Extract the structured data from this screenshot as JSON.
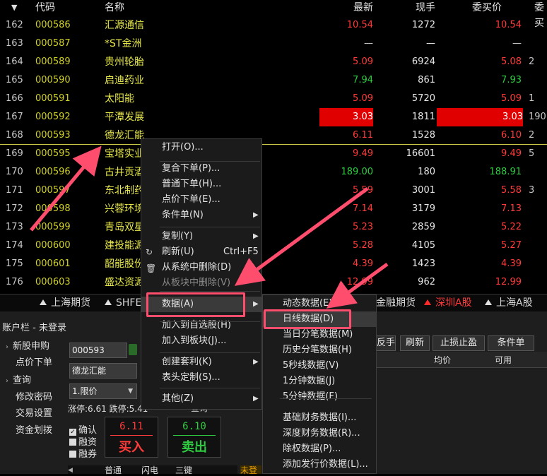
{
  "header": {
    "sort_arrow": "▼",
    "code": "代码",
    "name": "名称",
    "last": "最新",
    "current_vol": "现手",
    "bid": "委买价",
    "bid_vol": "委买"
  },
  "rows": [
    {
      "idx": "162",
      "code": "000586",
      "name": "汇源通信",
      "last": "10.54",
      "cur": "1272",
      "bid": "10.54",
      "bv": "",
      "dir": "up"
    },
    {
      "idx": "163",
      "code": "000587",
      "name": "*ST金洲",
      "last": "—",
      "cur": "—",
      "bid": "—",
      "bv": "",
      "dir": "flat"
    },
    {
      "idx": "164",
      "code": "000589",
      "name": "贵州轮胎",
      "last": "5.09",
      "cur": "6924",
      "bid": "5.08",
      "bv": "2",
      "dir": "up"
    },
    {
      "idx": "165",
      "code": "000590",
      "name": "启迪药业",
      "last": "7.94",
      "cur": "861",
      "bid": "7.93",
      "bv": "",
      "dir": "dn"
    },
    {
      "idx": "166",
      "code": "000591",
      "name": "太阳能",
      "last": "5.09",
      "cur": "5720",
      "bid": "5.09",
      "bv": "1",
      "dir": "up"
    },
    {
      "idx": "167",
      "code": "000592",
      "name": "平潭发展",
      "last": "3.03",
      "cur": "1811",
      "bid": "3.03",
      "bv": "190",
      "dir": "up",
      "hl": true
    },
    {
      "idx": "168",
      "code": "000593",
      "name": "德龙汇能",
      "last": "6.11",
      "cur": "1528",
      "bid": "6.10",
      "bv": "2",
      "dir": "up"
    },
    {
      "idx": "169",
      "code": "000595",
      "name": "宝塔实业",
      "last": "9.49",
      "cur": "16601",
      "bid": "9.49",
      "bv": "5",
      "dir": "up"
    },
    {
      "idx": "170",
      "code": "000596",
      "name": "古井贡酒",
      "last": "189.00",
      "cur": "180",
      "bid": "188.91",
      "bv": "",
      "dir": "dn"
    },
    {
      "idx": "171",
      "code": "000597",
      "name": "东北制药",
      "last": "5.59",
      "cur": "3001",
      "bid": "5.58",
      "bv": "3",
      "dir": "up"
    },
    {
      "idx": "172",
      "code": "000598",
      "name": "兴蓉环境",
      "last": "7.14",
      "cur": "3179",
      "bid": "7.13",
      "bv": "",
      "dir": "up"
    },
    {
      "idx": "173",
      "code": "000599",
      "name": "青岛双星",
      "last": "5.23",
      "cur": "2859",
      "bid": "5.22",
      "bv": "",
      "dir": "up"
    },
    {
      "idx": "174",
      "code": "000600",
      "name": "建投能源",
      "last": "5.28",
      "cur": "4105",
      "bid": "5.27",
      "bv": "",
      "dir": "up"
    },
    {
      "idx": "175",
      "code": "000601",
      "name": "韶能股份",
      "last": "4.39",
      "cur": "1423",
      "bid": "4.39",
      "bv": "",
      "dir": "up"
    },
    {
      "idx": "176",
      "code": "000603",
      "name": "盛达资源",
      "last": "12.99",
      "cur": "962",
      "bid": "12.99",
      "bv": "",
      "dir": "up"
    }
  ],
  "market_tabs": {
    "sh_futures": "上海期货",
    "shfe": "SHFE",
    "fin_futures": "金融期货",
    "sz_a": "深圳A股",
    "sh_a": "上海A股"
  },
  "account": {
    "title": "账户栏 - 未登录",
    "nav": [
      "新股申购",
      "点价下单",
      "查询",
      "修改密码",
      "交易设置",
      "资金划拨"
    ],
    "code_value": "000593",
    "name_value": "德龙汇能",
    "order_type": "1.限价",
    "limits": "涨停:6.61 跌停:5.41",
    "query_btn": "查询",
    "checks": [
      {
        "label": "确认",
        "checked": true
      },
      {
        "label": "融资",
        "checked": false
      },
      {
        "label": "融券",
        "checked": false
      }
    ],
    "buy_price": "6.11",
    "buy_label": "买入",
    "sell_price": "6.10",
    "sell_label": "卖出",
    "bottom_tabs": [
      "普通",
      "闪电",
      "三键"
    ],
    "right_buttons": [
      "反手",
      "刷新",
      "止损止盈",
      "条件单"
    ],
    "cols": [
      "均价",
      "可用"
    ],
    "partial_tab": "未登"
  },
  "context_menu": {
    "items": [
      {
        "label": "打开(O)..."
      },
      {
        "label": "复合下单(P)..."
      },
      {
        "label": "普通下单(H)..."
      },
      {
        "label": "点价下单(E)..."
      },
      {
        "label": "条件单(N)",
        "arrow": "▶"
      },
      {
        "label": "复制(Y)",
        "arrow": "▶"
      },
      {
        "label": "刷新(U)",
        "shortcut": "Ctrl+F5"
      },
      {
        "label": "从系统中删除(D)"
      },
      {
        "label": "从板块中删除(V)"
      },
      {
        "label": "数据(A)",
        "arrow": "▶"
      },
      {
        "label": "加入到自选股(H)"
      },
      {
        "label": "加入到板块(J)..."
      },
      {
        "label": "创建套利(K)",
        "arrow": "▶"
      },
      {
        "label": "表头定制(S)..."
      },
      {
        "label": "其他(Z)",
        "arrow": "▶"
      }
    ]
  },
  "submenu": {
    "items": [
      {
        "label": "动态数据(E)..."
      },
      {
        "label": "日线数据(D)"
      },
      {
        "label": "当日分笔数据(M)"
      },
      {
        "label": "历史分笔数据(H)"
      },
      {
        "label": "5秒线数据(V)"
      },
      {
        "label": "1分钟数据(J)"
      },
      {
        "label": "5分钟数据(F)"
      },
      {
        "label": "基础财务数据(I)..."
      },
      {
        "label": "深度财务数据(R)..."
      },
      {
        "label": "除权数据(P)..."
      },
      {
        "label": "添加发行价数据(L)..."
      }
    ]
  },
  "colors": {
    "up": "#ff3b3b",
    "down": "#2ecc40",
    "highlight": "#e00000",
    "annotation": "#ff4d6d"
  }
}
